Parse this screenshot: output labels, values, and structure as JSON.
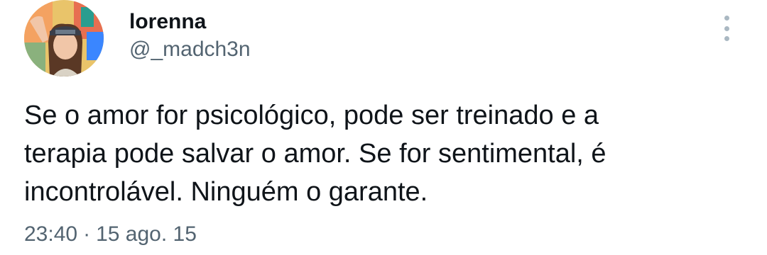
{
  "tweet": {
    "author": {
      "display_name": "lorenna",
      "handle": "@_madch3n"
    },
    "text_lines": [
      "Se o amor for psicológico, pode ser treinado e a",
      "terapia pode salvar o amor. Se for sentimental, é",
      "incontrolável. Ninguém o garante."
    ],
    "time": "23:40",
    "separator": "·",
    "date": "15 ago. 15"
  },
  "icons": {
    "more": "more-vertical-icon"
  },
  "colors": {
    "primary_text": "#0f1419",
    "secondary_text": "#536471",
    "more_icon": "#aab8c2"
  }
}
